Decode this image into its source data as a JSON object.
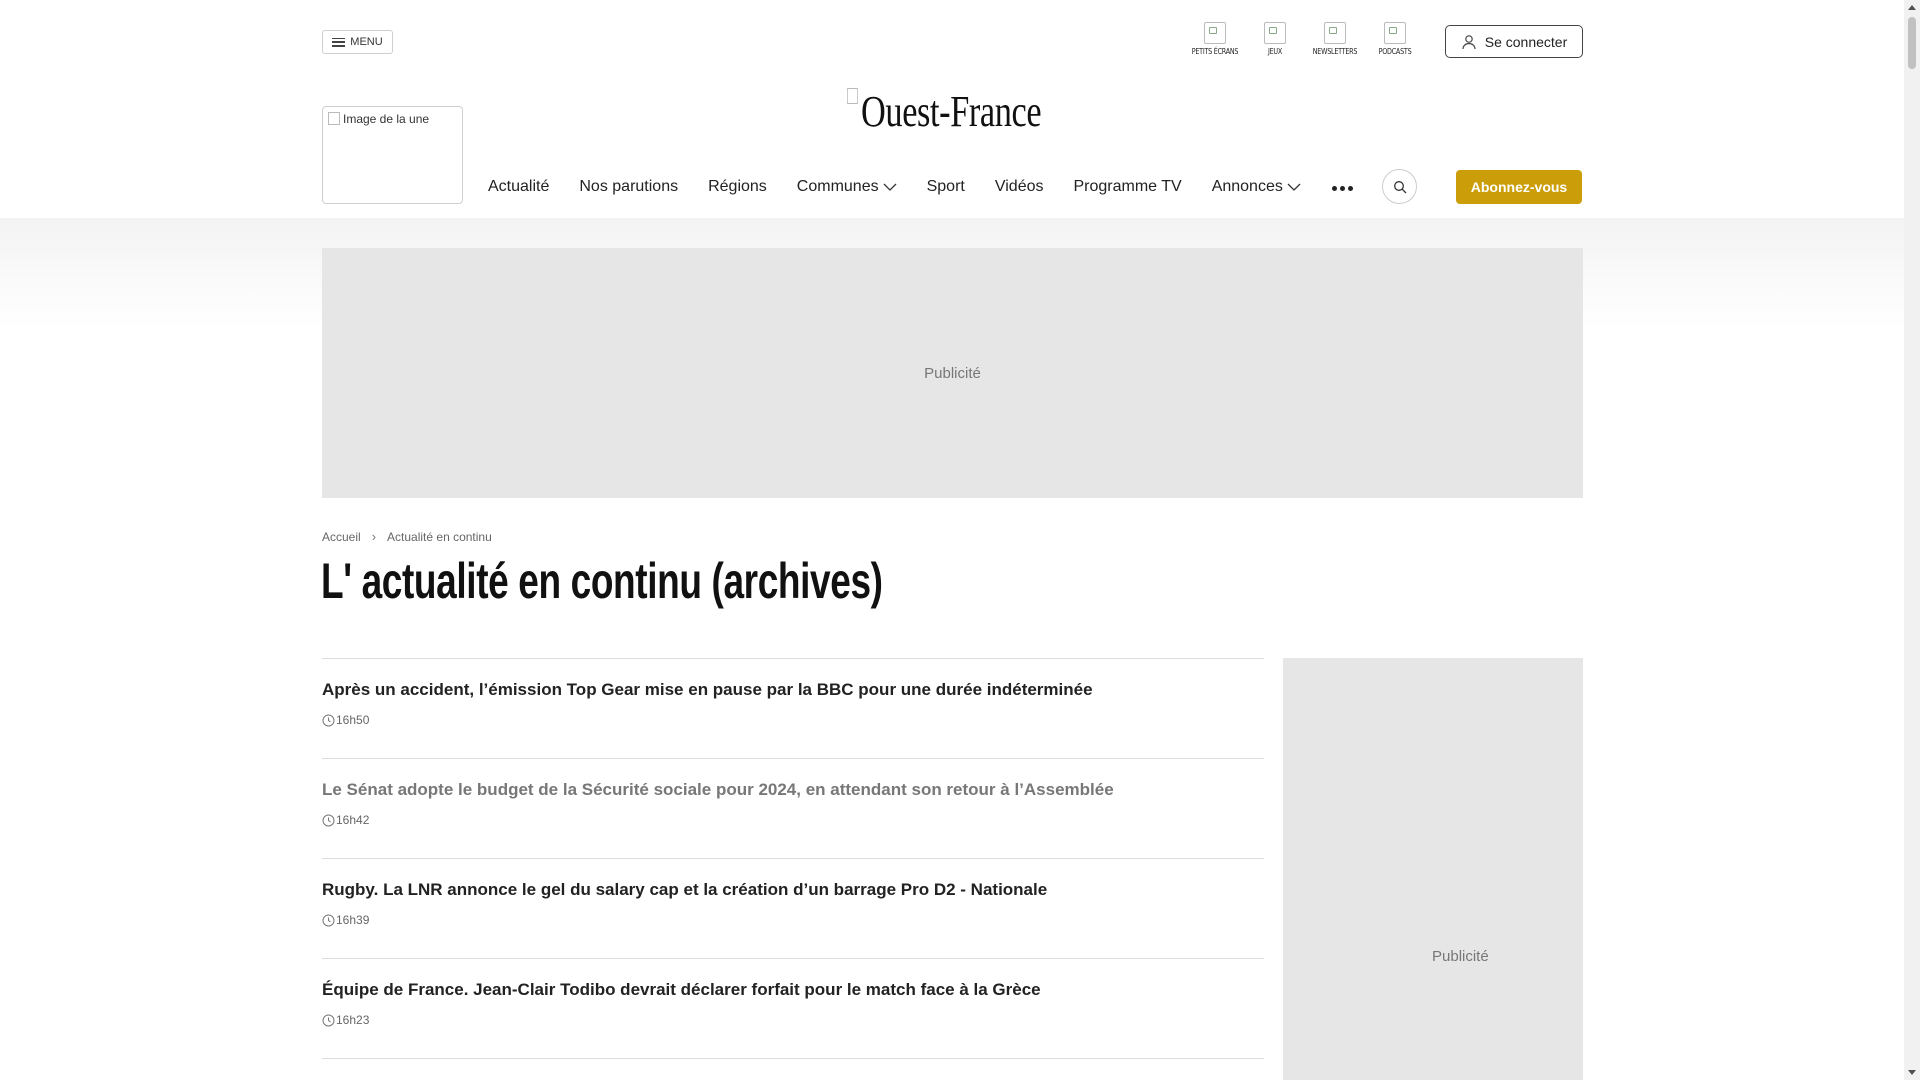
{
  "header": {
    "menu_label": "MENU",
    "quick_links": [
      {
        "label": "PETITS ÉCRANS",
        "icon": "tv-icon"
      },
      {
        "label": "JEUX",
        "icon": "games-icon"
      },
      {
        "label": "NEWSLETTERS",
        "icon": "newsletter-icon"
      },
      {
        "label": "PODCASTS",
        "icon": "podcast-icon"
      }
    ],
    "login_label": "Se connecter",
    "logo_alt": "Ouest-France",
    "une_alt": "Image de la une",
    "nav": [
      "Actualité",
      "Nos parutions",
      "Régions",
      "Communes",
      "Sport",
      "Vidéos",
      "Programme TV",
      "Annonces"
    ],
    "subscribe_label": "Abonnez-vous"
  },
  "ads": {
    "top_label": "Publicité",
    "side_label": "Publicité"
  },
  "breadcrumb": [
    "Accueil",
    "Actualité en continu"
  ],
  "page_title": "L' actualité en continu (archives)",
  "articles": [
    {
      "title": "Après un accident, l’émission Top Gear mise en pause par la BBC pour une durée indéterminée",
      "time": "16h50"
    },
    {
      "title": "Le Sénat adopte le budget de la Sécurité sociale pour 2024, en attendant son retour à l’Assemblée",
      "time": "16h42"
    },
    {
      "title": "Rugby. La LNR annonce le gel du salary cap et la création d’un barrage Pro D2 - Nationale",
      "time": "16h39"
    },
    {
      "title": "Équipe de France. Jean-Clair Todibo devrait déclarer forfait pour le match face à la Grèce",
      "time": "16h23"
    }
  ],
  "colors": {
    "subscribe_bg": "#cb9e09",
    "ad_bg": "#e6e6e6",
    "visited_article": "#777777"
  }
}
